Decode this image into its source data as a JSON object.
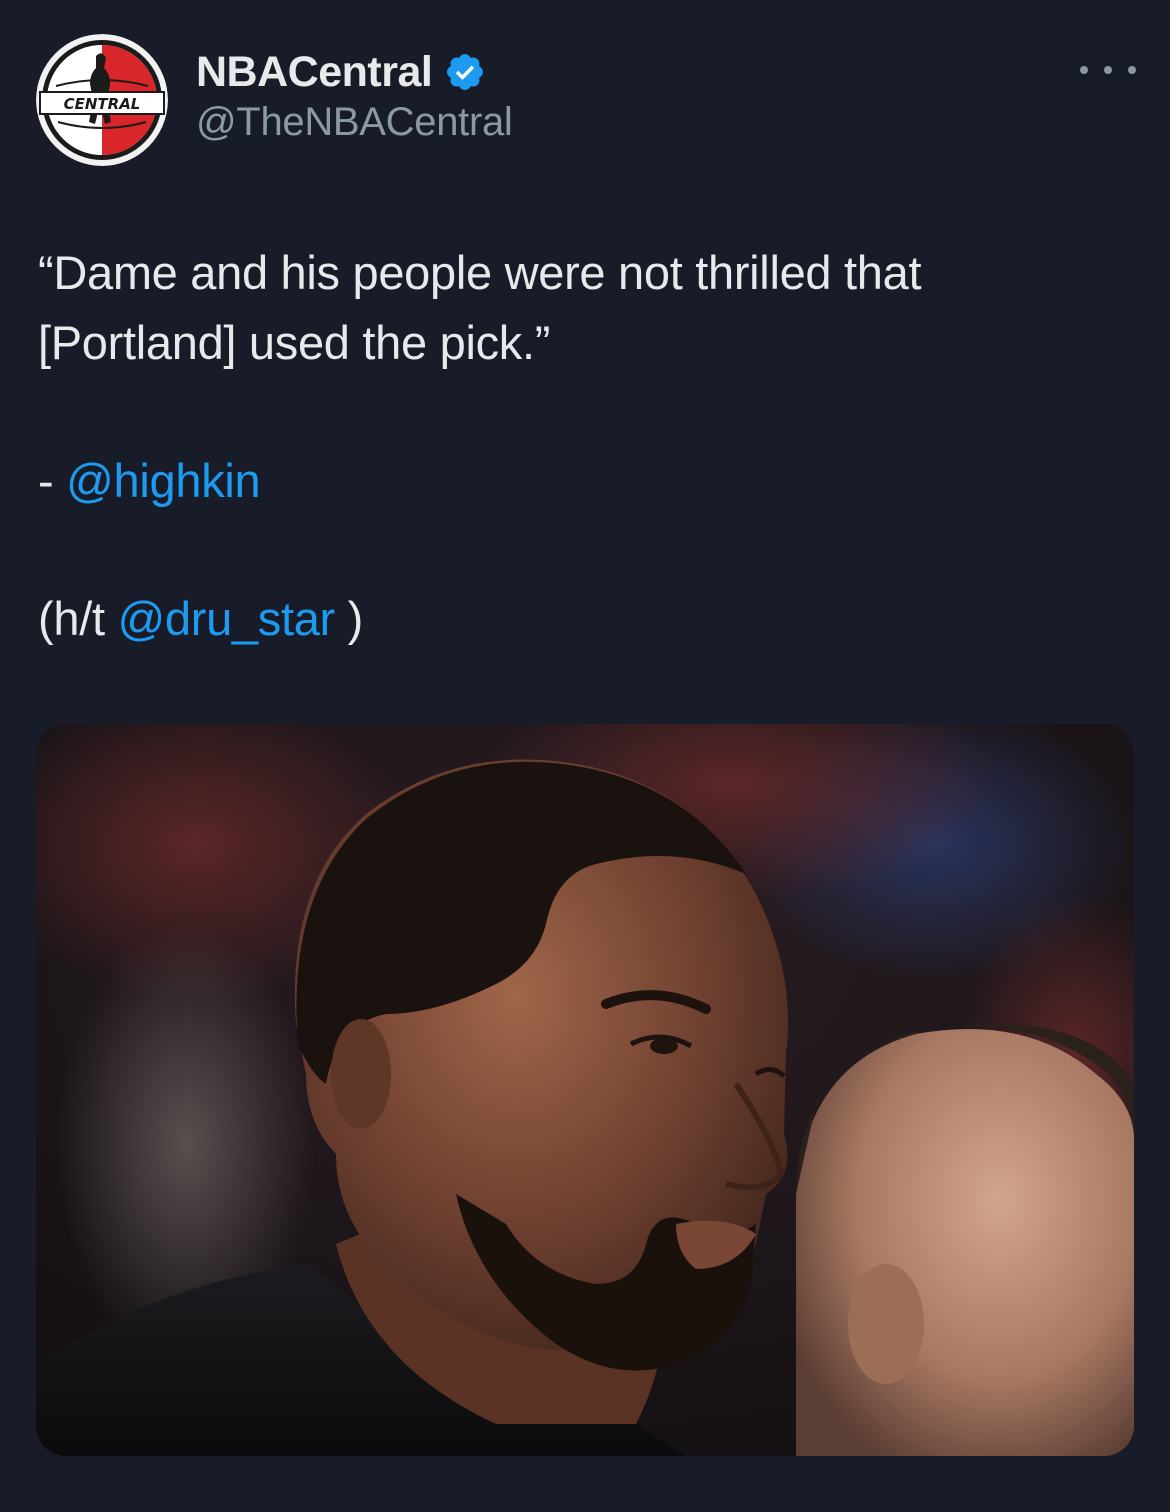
{
  "author": {
    "display_name": "NBACentral",
    "handle": "@TheNBACentral",
    "avatar_text": "CENTRAL",
    "verified": true
  },
  "tweet": {
    "quote_line1": "“Dame and his people were not thrilled that",
    "quote_line2": "[Portland] used the pick.”",
    "credit_prefix": "- ",
    "credit_mention": "@highkin",
    "ht_prefix": "(h/t ",
    "ht_mention": "@dru_star",
    "ht_suffix": " )"
  },
  "media": {
    "description": "photo-of-basketball-player"
  },
  "icons": {
    "verified": "verified-badge-icon",
    "more": "more-options-icon"
  },
  "colors": {
    "background": "#171c28",
    "text": "#e7e9ea",
    "secondary": "#8b98a5",
    "link": "#1d9bf0",
    "verified": "#1d9bf0"
  }
}
